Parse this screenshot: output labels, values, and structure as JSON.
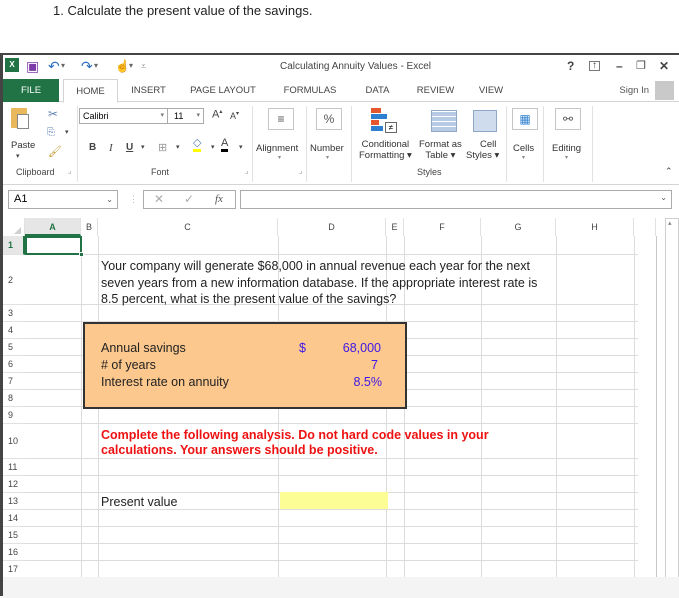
{
  "question": "1.  Calculate the present value of the savings.",
  "window": {
    "title": "Calculating Annuity Values - Excel",
    "controls": {
      "help": "?",
      "ribbon_display": "⊼",
      "minimize": "–",
      "restore": "🗗",
      "close": "✕"
    }
  },
  "tabs": [
    {
      "label": "FILE"
    },
    {
      "label": "HOME"
    },
    {
      "label": "INSERT"
    },
    {
      "label": "PAGE LAYOUT"
    },
    {
      "label": "FORMULAS"
    },
    {
      "label": "DATA"
    },
    {
      "label": "REVIEW"
    },
    {
      "label": "VIEW"
    }
  ],
  "sign_in": "Sign In",
  "ribbon": {
    "clipboard": {
      "paste": "Paste",
      "group": "Clipboard"
    },
    "font": {
      "name": "Calibri",
      "size": "11",
      "bold": "B",
      "italic": "I",
      "underline": "U",
      "group": "Font"
    },
    "alignment": {
      "label": "Alignment"
    },
    "number": {
      "label": "Number",
      "icon": "%"
    },
    "styles": {
      "conditional_1": "Conditional",
      "conditional_2": "Formatting ▾",
      "format_table_1": "Format as",
      "format_table_2": "Table ▾",
      "cell_styles_1": "Cell",
      "cell_styles_2": "Styles ▾",
      "group": "Styles"
    },
    "cells": {
      "label": "Cells"
    },
    "editing": {
      "label": "Editing"
    }
  },
  "formula_bar": {
    "name_box": "A1",
    "fx": "fx",
    "value": ""
  },
  "columns": [
    "A",
    "B",
    "C",
    "D",
    "E",
    "F",
    "G",
    "H"
  ],
  "rows": [
    "1",
    "2",
    "3",
    "4",
    "5",
    "6",
    "7",
    "8",
    "9",
    "10",
    "11",
    "12",
    "13",
    "14",
    "15",
    "16",
    "17"
  ],
  "sheet": {
    "problem_text": "Your company will generate $68,000 in annual revenue each year for the next seven years from a new information database. If the appropriate interest rate is 8.5 percent, what is the present value of the savings?",
    "inputs": [
      {
        "label": "Annual savings",
        "currency": "$",
        "value": "68,000"
      },
      {
        "label": "# of years",
        "currency": "",
        "value": "7"
      },
      {
        "label": "Interest rate on annuity",
        "currency": "",
        "value": "8.5%"
      }
    ],
    "instruction": "Complete the following analysis. Do not hard code values in your calculations. Your answers should be positive.",
    "present_value_label": "Present value",
    "present_value": ""
  },
  "colors": {
    "excel_green": "#217346",
    "input_box": "#fcc88d",
    "input_blue": "#3d16e8",
    "instruction_red": "#ee1111",
    "answer_yellow": "#fdfd95"
  }
}
